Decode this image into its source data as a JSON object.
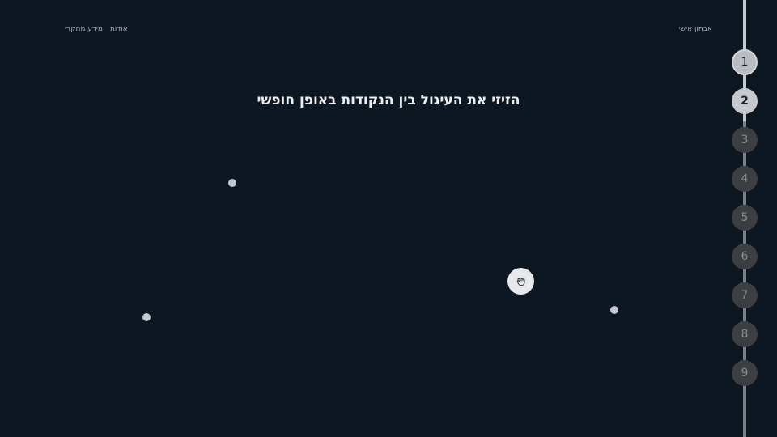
{
  "header": {
    "brand": "אבחון אישי",
    "nav": [
      "אודות",
      "מידע מחקרי"
    ]
  },
  "main": {
    "instruction": "הזיזי את העיגול בין הנקודות באופן חופשי"
  },
  "steps": {
    "items": [
      "1",
      "2",
      "3",
      "4",
      "5",
      "6",
      "7",
      "8",
      "9"
    ],
    "current": "2"
  },
  "colors": {
    "background": "#0d1722",
    "dot": "#c4c7cd",
    "handle": "#e7e8eb",
    "step_done": "#b9bcc2",
    "step_todo": "#3d3e42"
  },
  "icons": {
    "handle": "grab-hand-icon"
  }
}
